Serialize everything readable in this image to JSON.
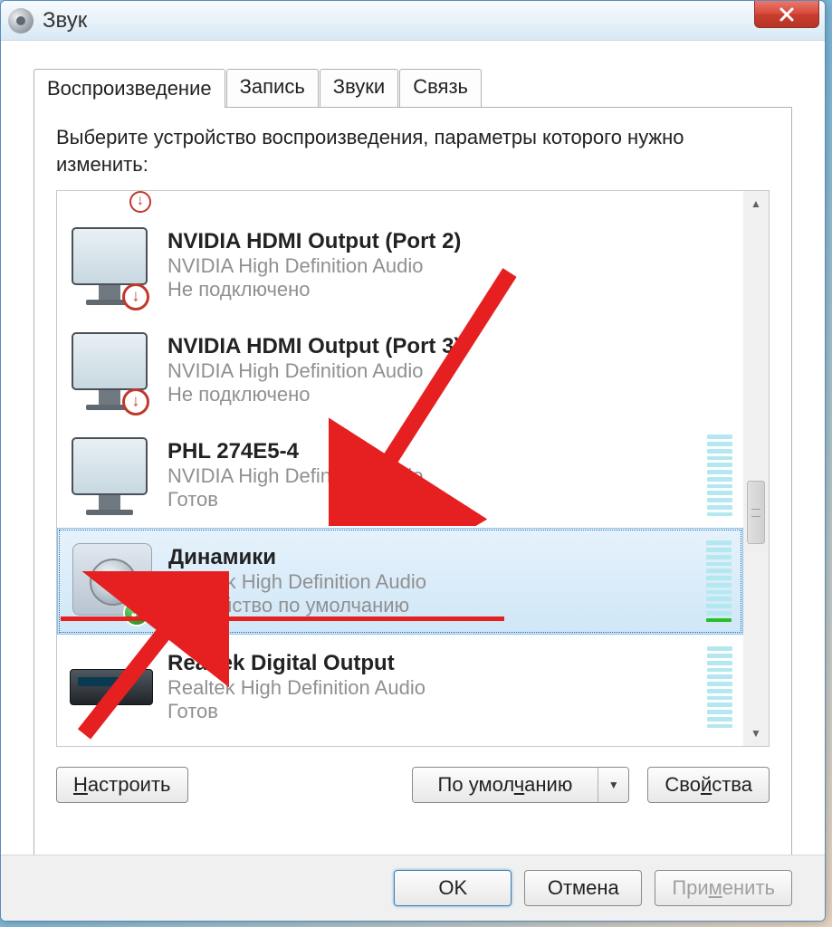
{
  "window": {
    "title": "Звук"
  },
  "tabs": {
    "playback": "Воспроизведение",
    "recording": "Запись",
    "sounds": "Звуки",
    "comm": "Связь"
  },
  "instruction": "Выберите устройство воспроизведения, параметры которого нужно изменить:",
  "devices": [
    {
      "name": "NVIDIA HDMI Output (Port 2)",
      "driver": "NVIDIA High Definition Audio",
      "status": "Не подключено",
      "icon": "monitor",
      "badge": "disconnected",
      "selected": false,
      "meter": false
    },
    {
      "name": "NVIDIA HDMI Output (Port 3)",
      "driver": "NVIDIA High Definition Audio",
      "status": "Не подключено",
      "icon": "monitor",
      "badge": "disconnected",
      "selected": false,
      "meter": false
    },
    {
      "name": "PHL 274E5-4",
      "driver": "NVIDIA High Definition Audio",
      "status": "Готов",
      "icon": "monitor",
      "badge": null,
      "selected": false,
      "meter": true,
      "meter_active": 0
    },
    {
      "name": "Динамики",
      "driver": "Realtek High Definition Audio",
      "status": "Устройство по умолчанию",
      "icon": "speaker",
      "badge": "default",
      "selected": true,
      "meter": true,
      "meter_active": 1
    },
    {
      "name": "Realtek Digital Output",
      "driver": "Realtek High Definition Audio",
      "status": "Готов",
      "icon": "digital",
      "badge": null,
      "selected": false,
      "meter": true,
      "meter_active": 0
    }
  ],
  "buttons": {
    "configure": "Настроить",
    "set_default": "По умолчанию",
    "properties": "Свойства",
    "ok": "OK",
    "cancel": "Отмена",
    "apply": "Применить"
  }
}
